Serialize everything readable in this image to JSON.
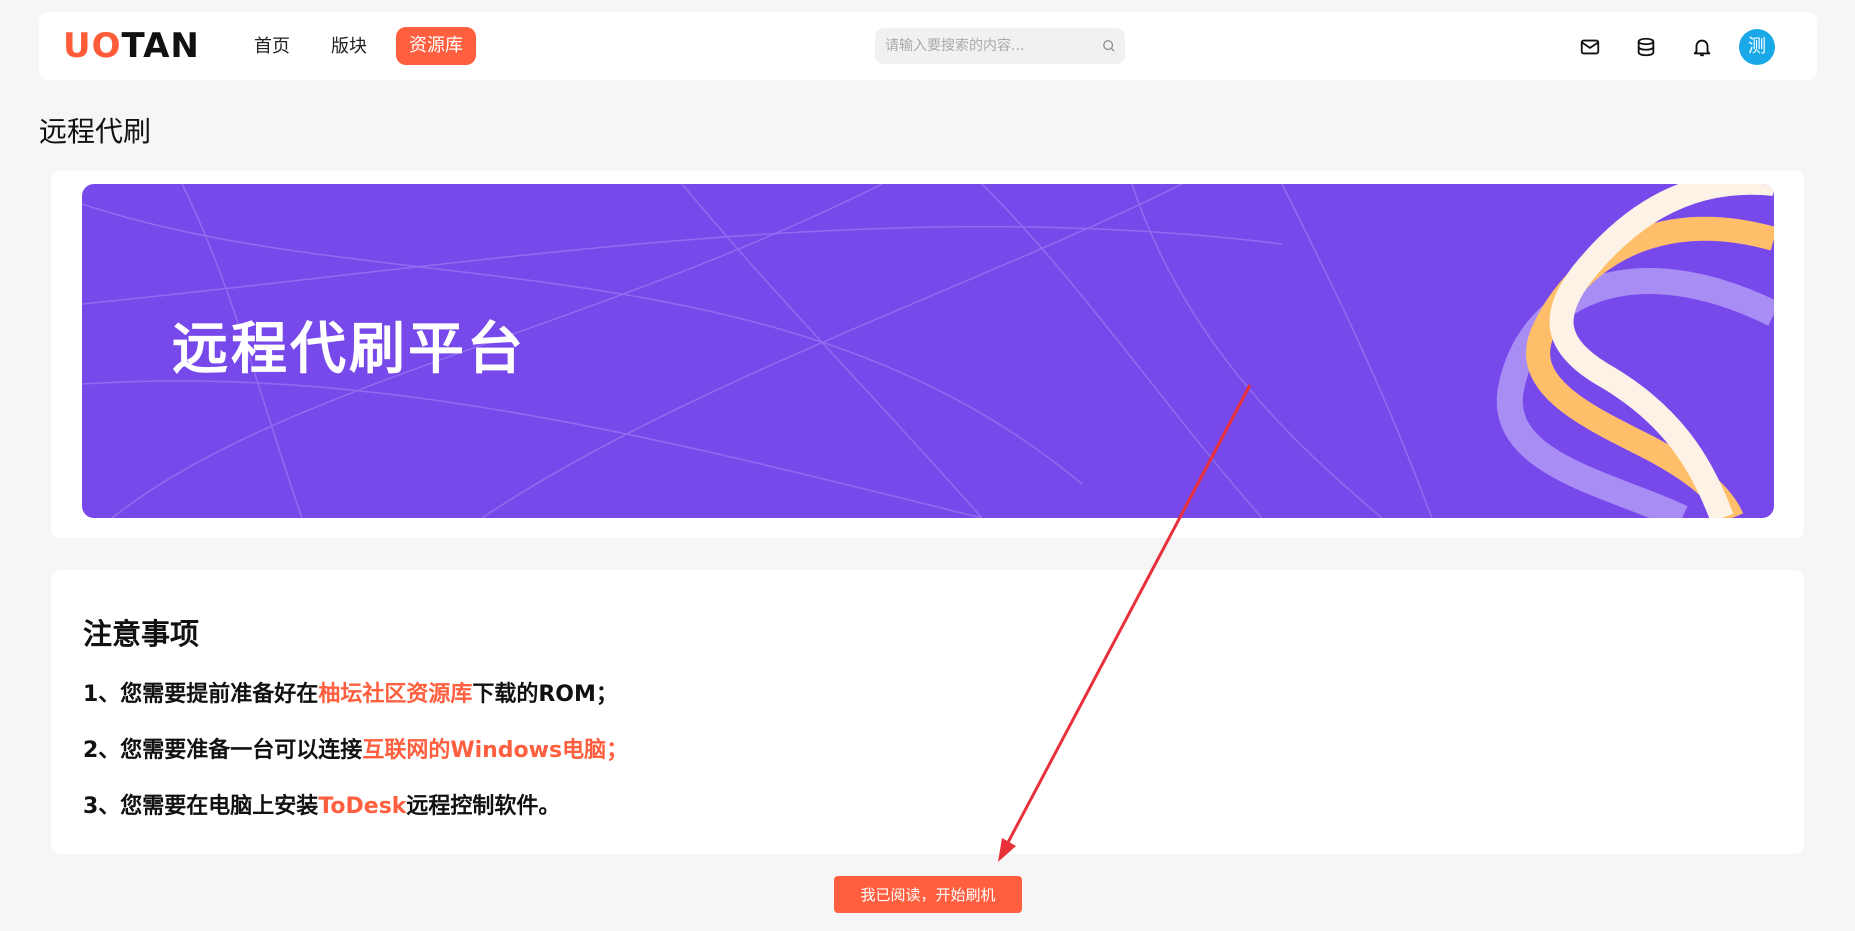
{
  "header": {
    "logo_part1": "UO",
    "logo_part2": "TAN",
    "nav": [
      {
        "label": "首页"
      },
      {
        "label": "版块"
      },
      {
        "label": "资源库"
      }
    ],
    "search_placeholder": "请输入要搜索的内容...",
    "avatar_text": "测",
    "icons": [
      "mail-icon",
      "database-icon",
      "bell-icon",
      "search-icon"
    ]
  },
  "page": {
    "title": "远程代刷",
    "banner_title": "远程代刷平台"
  },
  "notes": {
    "title": "注意事项",
    "items": [
      {
        "pre": "1、您需要提前准备好在",
        "highlight": "柚坛社区资源库",
        "post": "下载的ROM；"
      },
      {
        "pre": "2、您需要准备一台可以连接",
        "highlight": "互联网的Windows电脑；",
        "post": ""
      },
      {
        "pre": "3、您需要在电脑上安装",
        "highlight": "ToDesk",
        "post": "远程控制软件。"
      }
    ]
  },
  "action": {
    "start_label": "我已阅读，开始刷机"
  },
  "colors": {
    "accent": "#ff5f3e",
    "banner": "#7749eb",
    "avatar": "#19a9e8"
  }
}
